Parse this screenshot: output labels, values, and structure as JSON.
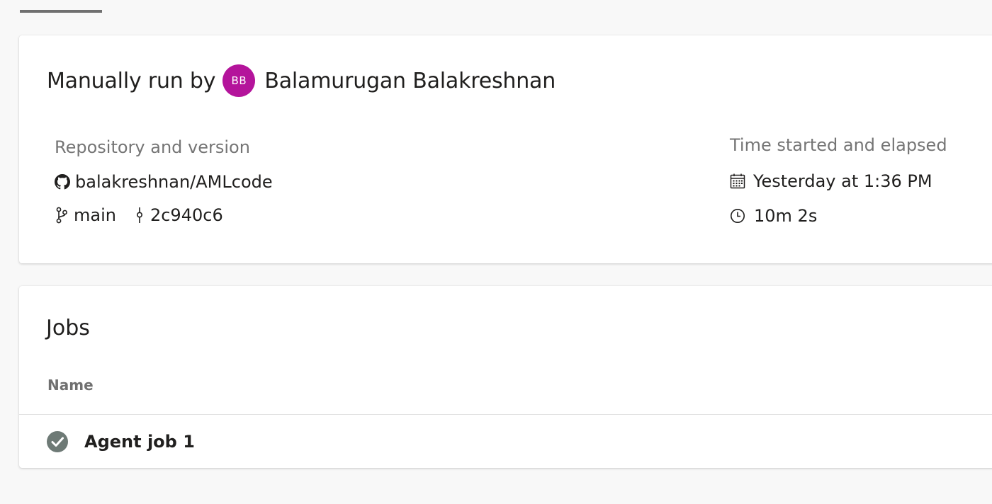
{
  "header": {
    "run_prefix": "Manually run by",
    "avatar_initials": "BB",
    "user_name": "Balamurugan Balakreshnan"
  },
  "repository": {
    "label": "Repository and version",
    "repo": "balakreshnan/AMLcode",
    "branch": "main",
    "commit": "2c940c6"
  },
  "timing": {
    "label": "Time started and elapsed",
    "started": "Yesterday at 1:36 PM",
    "elapsed": "10m 2s"
  },
  "jobs": {
    "title": "Jobs",
    "column_name": "Name",
    "items": [
      {
        "name": "Agent job 1",
        "status": "succeeded",
        "status_icon": "check-circle-icon"
      }
    ]
  },
  "colors": {
    "avatar": "#b4149b",
    "status_success": "#6e7a76",
    "label_gray": "#757575",
    "background": "#f8f8f8"
  },
  "icons": {
    "repo": "github-icon",
    "branch": "branch-icon",
    "commit": "commit-icon",
    "calendar": "calendar-icon",
    "clock": "clock-icon"
  }
}
